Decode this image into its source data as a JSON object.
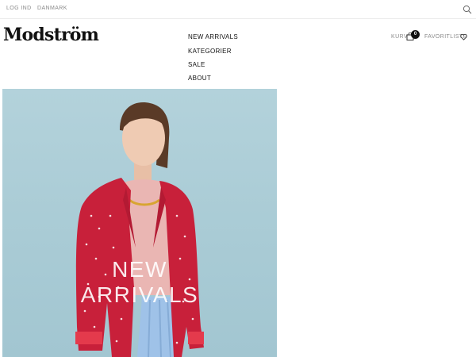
{
  "topbar": {
    "login_label": "LOG IND",
    "country_label": "DANMARK"
  },
  "header": {
    "logo_text": "Modström",
    "nav_items": [
      {
        "label": "NEW ARRIVALS"
      },
      {
        "label": "KATEGORIER"
      },
      {
        "label": "SALE"
      },
      {
        "label": "ABOUT"
      }
    ],
    "cart_label": "KURV",
    "cart_count": "0",
    "favorites_label": "FAVORITLISTE"
  },
  "hero": {
    "title_line1": "NEW",
    "title_line2": "ARRIVALS"
  },
  "colors": {
    "hero_background": "#a9cbd5",
    "jacket": "#c8203a",
    "skirt": "#9fc2e8",
    "text_muted": "#8a8a8a"
  },
  "icons": [
    "search-icon",
    "bag-icon",
    "heart-icon"
  ]
}
